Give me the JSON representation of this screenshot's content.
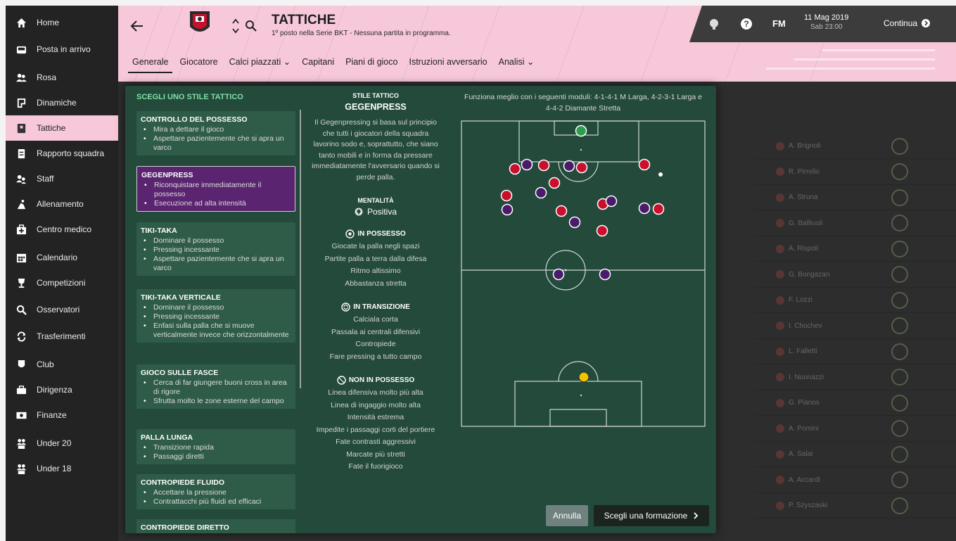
{
  "sidebar": {
    "items": [
      {
        "label": "Home",
        "icon": "home-icon"
      },
      {
        "label": "Posta in arrivo",
        "icon": "inbox-icon"
      },
      {
        "label": "Rosa",
        "icon": "squad-icon"
      },
      {
        "label": "Dinamiche",
        "icon": "dynamics-icon"
      },
      {
        "label": "Tattiche",
        "icon": "tactics-icon",
        "active": true
      },
      {
        "label": "Rapporto squadra",
        "icon": "report-icon"
      },
      {
        "label": "Staff",
        "icon": "staff-icon"
      },
      {
        "label": "Allenamento",
        "icon": "training-icon"
      },
      {
        "label": "Centro medico",
        "icon": "medical-icon"
      },
      {
        "label": "Calendario",
        "icon": "calendar-icon"
      },
      {
        "label": "Competizioni",
        "icon": "trophy-icon"
      },
      {
        "label": "Osservatori",
        "icon": "scouting-icon"
      },
      {
        "label": "Trasferimenti",
        "icon": "transfers-icon"
      },
      {
        "label": "Club",
        "icon": "club-icon"
      },
      {
        "label": "Dirigenza",
        "icon": "board-icon"
      },
      {
        "label": "Finanze",
        "icon": "finances-icon"
      },
      {
        "label": "Under 20",
        "icon": "u20-icon"
      },
      {
        "label": "Under 18",
        "icon": "u18-icon"
      }
    ]
  },
  "header": {
    "title": "TATTICHE",
    "subtitle": "1º posto nella Serie BKT - Nessuna partita in programma.",
    "tabs": [
      {
        "label": "Generale",
        "active": true
      },
      {
        "label": "Giocatore"
      },
      {
        "label": "Calci piazzati ⌄"
      },
      {
        "label": "Capitani"
      },
      {
        "label": "Piani di gioco"
      },
      {
        "label": "Istruzioni avversario"
      },
      {
        "label": "Analisi ⌄"
      }
    ],
    "fm_logo": "FM",
    "date": "11 Mag 2019",
    "time": "Sab 23:00",
    "continue_label": "Continua"
  },
  "dialog": {
    "list_title": "SCEGLI UNO STILE TATTICO",
    "styles": [
      {
        "name": "CONTROLLO DEL POSSESSO",
        "points": [
          "Mira a dettare il gioco",
          "Aspettare pazientemente che si apra un varco"
        ]
      },
      {
        "name": "GEGENPRESS",
        "selected": true,
        "points": [
          "Riconquistare immediatamente il possesso",
          "Esecuzione ad alta intensità"
        ]
      },
      {
        "name": "TIKI-TAKA",
        "points": [
          "Dominare il possesso",
          "Pressing incessante",
          "Aspettare pazientemente che si apra un varco"
        ]
      },
      {
        "name": "TIKI-TAKA VERTICALE",
        "points": [
          "Dominare il possesso",
          "Pressing incessante",
          "Enfasi sulla palla che si muove verticalmente invece che orizzontalmente"
        ]
      },
      {
        "name": "GIOCO SULLE FASCE",
        "points": [
          "Cerca di far giungere buoni cross in area di rigore",
          "Sfrutta molto le zone esterne del campo"
        ]
      },
      {
        "name": "PALLA LUNGA",
        "points": [
          "Transizione rapida",
          "Passaggi diretti"
        ]
      },
      {
        "name": "CONTROPIEDE FLUIDO",
        "points": [
          "Accettare la pressione",
          "Contrattacchi più fluidi ed efficaci"
        ]
      },
      {
        "name": "CONTROPIEDE DIRETTO",
        "points": []
      }
    ],
    "style_label": "STILE TATTICO",
    "style_name": "GEGENPRESS",
    "style_description": "Il Gegenpressing si basa sul principio che tutti i giocatori della squadra lavorino sodo e, soprattutto, che siano tanto mobili e in forma da pressare immediatamente l'avversario quando si perde palla.",
    "mentality_label": "MENTALITÀ",
    "mentality_value": "Positiva",
    "in_possession_label": "IN POSSESSO",
    "in_possession": [
      "Giocate la palla negli spazi",
      "Partite palla a terra dalla difesa",
      "Ritmo altissimo",
      "Abbastanza stretta"
    ],
    "in_transition_label": "IN TRANSIZIONE",
    "in_transition": [
      "Calciala corta",
      "Passala ai centrali difensivi",
      "Contropiede",
      "Fare pressing a tutto campo"
    ],
    "out_possession_label": "NON IN POSSESSO",
    "out_possession": [
      "Linea difensiva molto più alta",
      "Linea di ingaggio molto alta",
      "Intensità estrema",
      "Impedite i passaggi corti del portiere",
      "Fate contrasti aggressivi",
      "Marcate più stretti",
      "Fate il fuorigioco"
    ],
    "formations_text": "Funziona meglio con i seguenti moduli: 4-1-4-1 M Larga, 4-2-3-1 Larga e 4-4-2 Diamante Stretta",
    "cancel_label": "Annulla",
    "choose_label": "Scegli una formazione",
    "colors": {
      "own_team": "#c8102e",
      "opponent": "#4a1a6b",
      "opp_keeper": "#2e9e4d",
      "own_keeper": "#f2c400"
    }
  },
  "background": {
    "players": [
      "A. Brignoli",
      "R. Pirrello",
      "A. Struna",
      "G. Balfiuoli",
      "A. Rispoli",
      "G. Bongazan",
      "F. Lozzi",
      "I. Chochev",
      "L. Falletti",
      "I. Nuonazzi",
      "G. Pianos",
      "A. Pomini",
      "A. Salai",
      "A. Accardi",
      "P. Szyszaski"
    ]
  }
}
